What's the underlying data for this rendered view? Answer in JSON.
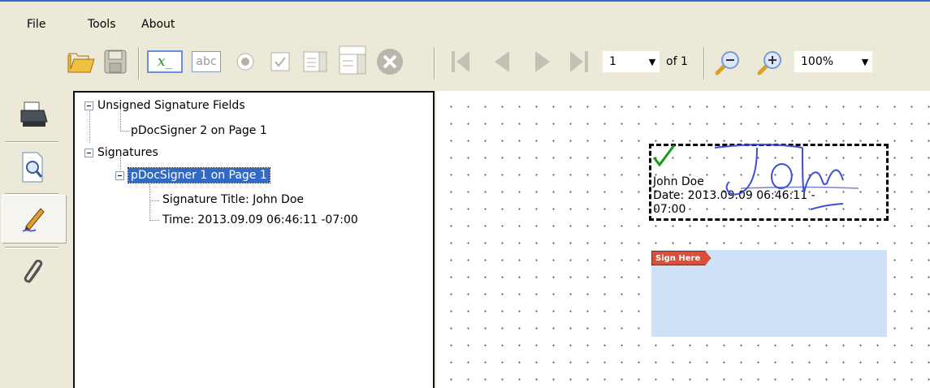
{
  "menu": {
    "file": "File",
    "tools": "Tools",
    "about": "About"
  },
  "toolbar": {
    "page_number": "1",
    "of_label": "of 1",
    "zoom": "100%",
    "text_field_icon_label": "x_",
    "abc_label": "abc"
  },
  "tree": {
    "unsigned_group": "Unsigned Signature Fields",
    "unsigned_item": "pDocSigner 2 on Page 1",
    "signatures_group": "Signatures",
    "signed_item": "pDocSigner 1 on Page 1",
    "signature_title": "Signature Title: John Doe",
    "signature_time": "Time: 2013.09.09 06:46:11 -07:00"
  },
  "document": {
    "signer_name": "John Doe",
    "date_line1": "Date: 2013.09.09 06:46:11 -",
    "date_line2": "07:00",
    "sign_here": "Sign Here"
  },
  "colors": {
    "selection": "#316ac5",
    "sign_here_tag": "#d8503c",
    "sign_field": "#cfe1f7",
    "signature_ink": "#3e4fd0",
    "check": "#1a9a1a"
  }
}
